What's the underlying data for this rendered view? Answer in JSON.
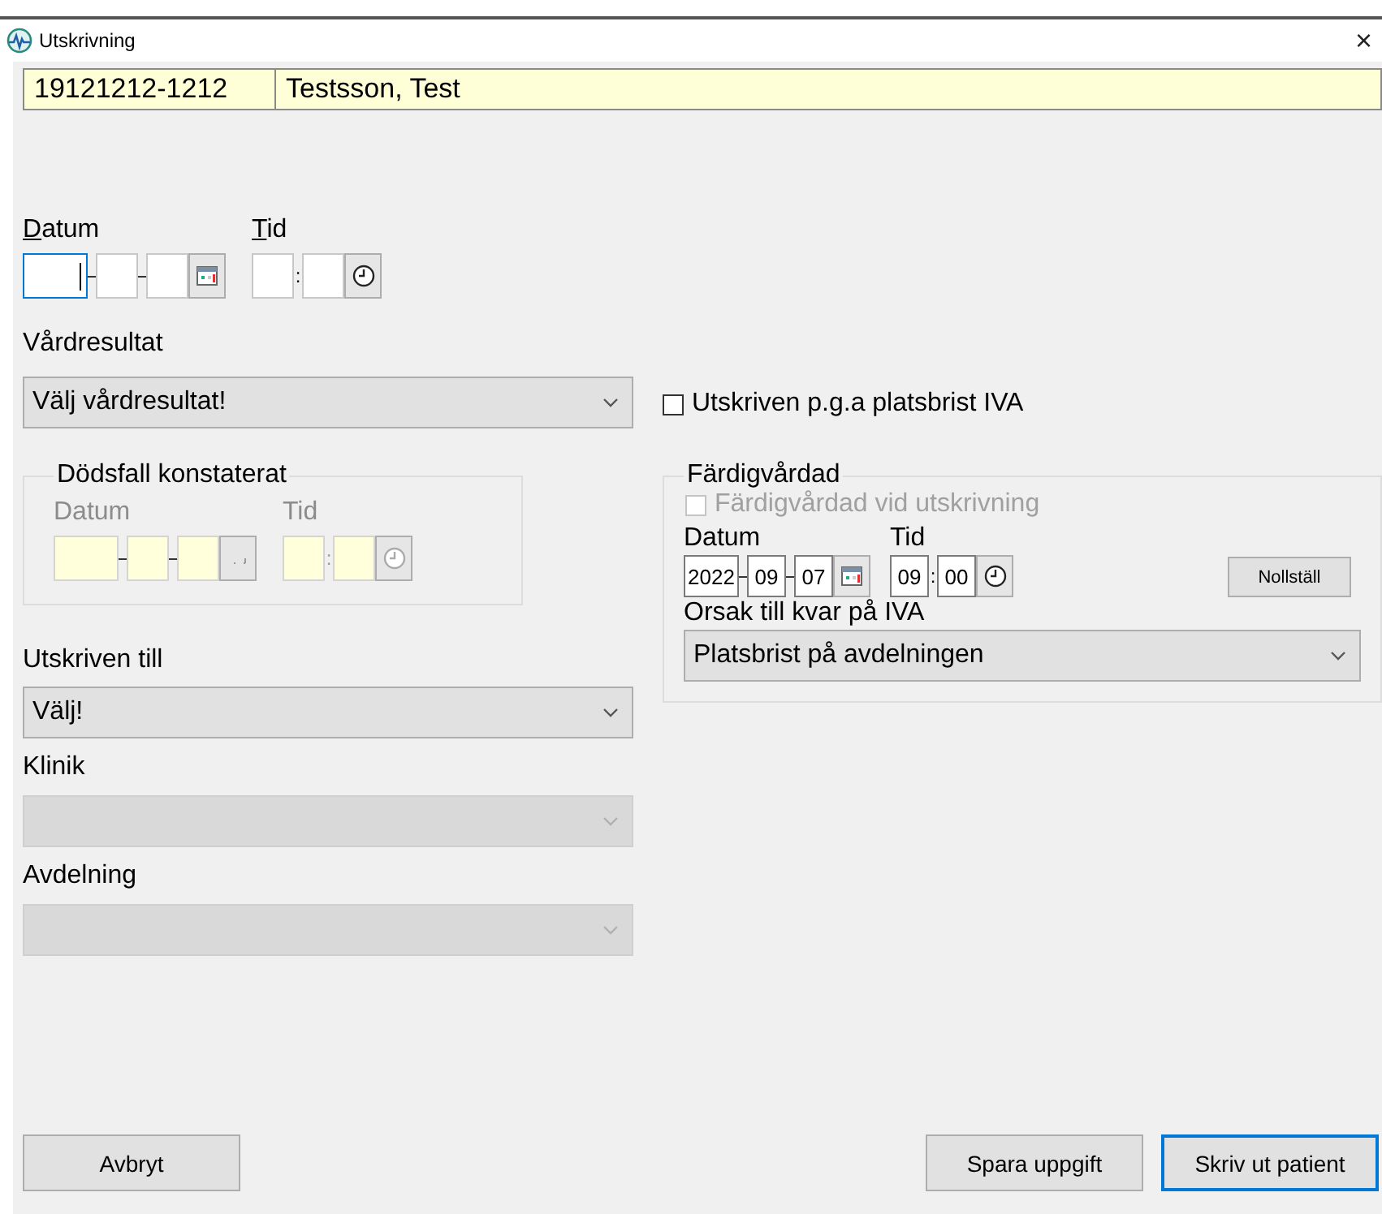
{
  "window": {
    "title": "Utskrivning",
    "close_glyph": "×"
  },
  "patient": {
    "id": "19121212-1212",
    "name": "Testsson, Test"
  },
  "discharge_time": {
    "date_label": "Datum",
    "time_label": "Tid",
    "underlined_access_keys": true,
    "focused": true,
    "disabled": false,
    "time_separator": ":"
  },
  "care_result": {
    "label": "Vårdresultat",
    "value": "Välj vårdresultat!",
    "disabled": false
  },
  "capacity_checkbox": {
    "label": "Utskriven p.g.a platsbrist IVA",
    "checked": false,
    "disabled": false
  },
  "death": {
    "title": "Dödsfall konstaterat",
    "date_label": "Datum",
    "time_label": "Tid",
    "disabled": true,
    "time_separator": ":"
  },
  "ready": {
    "title": "Färdigvårdad",
    "checkbox": {
      "label": "Färdigvårdad vid utskrivning",
      "checked": false,
      "disabled": true
    },
    "date_label": "Datum",
    "time_label": "Tid",
    "disabled": false,
    "year": "2022",
    "month": "09",
    "day": "07",
    "hour": "09",
    "minute": "00",
    "time_separator": ":",
    "reset_button": "Nollställ",
    "reason_label": "Orsak till kvar på IVA",
    "reason_value": "Platsbrist på avdelningen",
    "reason_disabled": false
  },
  "discharged_to": {
    "label": "Utskriven till",
    "value": "Välj!",
    "disabled": false
  },
  "clinic": {
    "label": "Klinik",
    "disabled": true
  },
  "ward": {
    "label": "Avdelning",
    "disabled": true
  },
  "buttons": [
    {
      "label": "Avbryt",
      "kind": "cancel",
      "focused": false
    },
    {
      "label": "Spara uppgift",
      "kind": "action",
      "focused": false
    },
    {
      "label": "Skriv ut patient",
      "kind": "action",
      "focused": true
    }
  ]
}
